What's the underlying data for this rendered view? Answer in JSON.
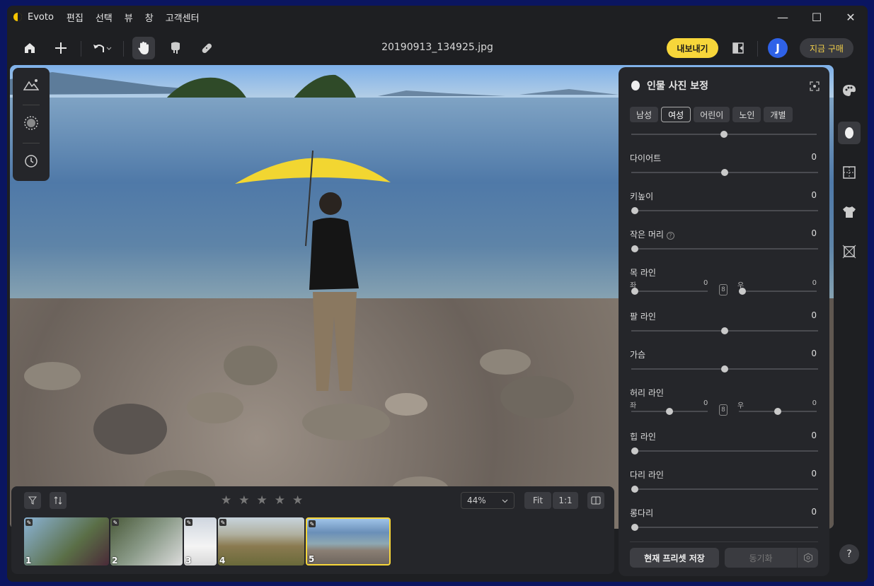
{
  "app": {
    "name": "Evoto"
  },
  "menu": [
    "편집",
    "선택",
    "뷰",
    "창",
    "고객센터"
  ],
  "window_controls": {
    "minimize": "—",
    "maximize": "☐",
    "close": "✕"
  },
  "toolbar": {
    "filename": "20190913_134925.jpg",
    "export_label": "내보내기",
    "avatar_letter": "J",
    "buy_label": "지금 구매"
  },
  "panel": {
    "title": "인물 사진 보정",
    "tabs": [
      "남성",
      "여성",
      "어린이",
      "노인",
      "개별"
    ],
    "active_tab": "여성",
    "sliders": [
      {
        "label": "다이어트",
        "value": "0",
        "level": 0.5
      },
      {
        "label": "키높이",
        "value": "0",
        "level": 0.0
      },
      {
        "label": "작은 머리",
        "value": "0",
        "level": 0.0
      },
      {
        "label": "팔 라인",
        "value": "0",
        "level": 0.5
      },
      {
        "label": "가슴",
        "value": "0",
        "level": 0.5
      },
      {
        "label": "힙 라인",
        "value": "0",
        "level": 0.0
      },
      {
        "label": "다리 라인",
        "value": "0",
        "level": 0.0
      },
      {
        "label": "롱다리",
        "value": "0",
        "level": 0.0
      }
    ],
    "neck": {
      "label": "목 라인",
      "left_label": "좌",
      "left_value": "0",
      "left_level": 0.0,
      "right_label": "우",
      "right_value": "0",
      "right_level": 0.0
    },
    "waist": {
      "label": "허리 라인",
      "left_label": "좌",
      "left_value": "0",
      "left_level": 0.5,
      "right_label": "우",
      "right_value": "0",
      "right_level": 0.5
    },
    "save_preset_label": "현재 프리셋 저장",
    "sync_label": "동기화"
  },
  "filmstrip": {
    "zoom": "44%",
    "fit_label": "Fit",
    "one_to_one_label": "1:1",
    "rating": 0,
    "thumbnails": [
      "1",
      "2",
      "3",
      "4",
      "5"
    ],
    "selected": "5"
  },
  "colors": {
    "accent": "#f7d63a",
    "avatar": "#2f62e8",
    "panel": "#25262a",
    "window": "#1e1f22"
  }
}
